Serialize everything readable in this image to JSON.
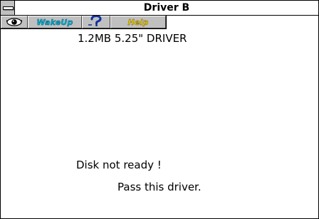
{
  "window": {
    "title": "Driver B"
  },
  "toolbar": {
    "eye_icon": "eye-icon",
    "wakeup_label": "WakeUp",
    "question_icon": "question-icon",
    "help_label": "Help"
  },
  "content": {
    "drive_label": "1.2MB 5.25\" DRIVER",
    "status_message": "Disk not ready !",
    "action_message": "Pass this driver."
  },
  "colors": {
    "wakeup_text": "#00b8d8",
    "help_text": "#e8d000",
    "toolbar_bg": "#c0c0c0"
  }
}
